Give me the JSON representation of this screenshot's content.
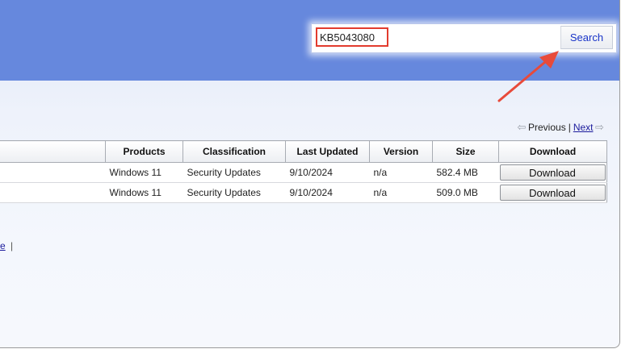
{
  "search": {
    "value": "KB5043080",
    "button_label": "Search"
  },
  "pager": {
    "previous_label": "Previous",
    "separator": "|",
    "next_label": "Next"
  },
  "table": {
    "headers": {
      "products": "Products",
      "classification": "Classification",
      "last_updated": "Last Updated",
      "version": "Version",
      "size": "Size",
      "download": "Download"
    },
    "rows": [
      {
        "products": "Windows 11",
        "classification": "Security Updates",
        "last_updated": "9/10/2024",
        "version": "n/a",
        "size": "582.4 MB",
        "download_label": "Download"
      },
      {
        "products": "Windows 11",
        "classification": "Security Updates",
        "last_updated": "9/10/2024",
        "version": "n/a",
        "size": "509.0 MB",
        "download_label": "Download"
      }
    ]
  },
  "footer": {
    "link_fragment": "e",
    "separator": "|"
  },
  "colors": {
    "header_band": "#6688dd",
    "highlight": "#e23b2e",
    "link": "#1a1a9c"
  }
}
